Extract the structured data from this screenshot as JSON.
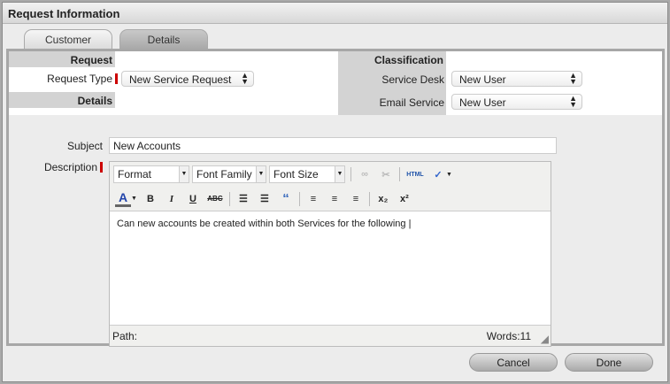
{
  "title": "Request Information",
  "tabs": [
    {
      "label": "Customer"
    },
    {
      "label": "Details"
    }
  ],
  "form": {
    "request_header": "Request",
    "request_type_label": "Request Type",
    "request_type_value": "New Service Request",
    "details_header": "Details",
    "classification_header": "Classification",
    "service_desk_label": "Service Desk",
    "service_desk_value": "New User",
    "email_service_label": "Email Service",
    "email_service_value": "New User",
    "subject_label": "Subject",
    "subject_value": "New Accounts",
    "description_label": "Description"
  },
  "editor": {
    "format": "Format",
    "font_family": "Font Family",
    "font_size": "Font Size",
    "html": "HTML",
    "content": "Can new accounts be created within both Services for the following",
    "path_label": "Path:",
    "word_count": "Words:11"
  },
  "buttons": {
    "cancel": "Cancel",
    "done": "Done"
  }
}
